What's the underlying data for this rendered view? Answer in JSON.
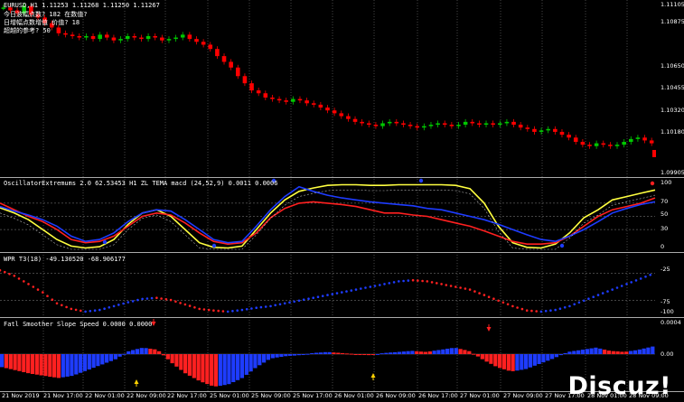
{
  "header": {
    "symbol_line": "EURUSD,H1  1.11253 1.11268 1.11250 1.11267",
    "info_lines": [
      "今日波幅点数? 182 在数值?",
      "日增幅点数增值 价值? 18",
      "超越的参考? 50"
    ]
  },
  "indicators": {
    "osc_title": "OscillatorExtremums 2.0 62.53453  H1 ZL TEMA macd (24,52,9) 0.0011 0.0006",
    "wpr_title": "WPR T3(18) -49.130520 -68.906177",
    "fss_title": "Fatl Smoother Slope Speed 0.0000 0.0000"
  },
  "axes": {
    "price_ticks": [
      "1.11105",
      "1.10875",
      "1.10650",
      "1.10455",
      "1.10320",
      "1.10180",
      "1.09905"
    ],
    "osc_ticks": [
      "100",
      "70",
      "50",
      "30",
      "0"
    ],
    "wpr_ticks": [
      "-25",
      "-75",
      "-100"
    ],
    "fss_ticks": [
      "0.0004",
      "0.00"
    ],
    "time_ticks": [
      "21 Nov 2019",
      "21 Nov 17:00",
      "22 Nov 01:00",
      "22 Nov 09:00",
      "22 Nov 17:00",
      "25 Nov 01:00",
      "25 Nov 09:00",
      "25 Nov 17:00",
      "26 Nov 01:00",
      "26 Nov 09:00",
      "26 Nov 17:00",
      "27 Nov 01:00",
      "27 Nov 09:00",
      "27 Nov 17:00",
      "28 Nov 01:00",
      "28 Nov 09:00"
    ]
  },
  "watermark": "Discuz!",
  "colors": {
    "bull": "#00c800",
    "bear": "#ff0000",
    "yellow": "#ffff40",
    "blue": "#1e3cff",
    "red": "#ff2020",
    "grid": "#ffffff",
    "axis": "#aaaaaa"
  },
  "chart_data": [
    {
      "type": "line",
      "panel": "price",
      "series": [
        {
          "name": "EURUSD,H1",
          "values": [
            1.1108,
            1.1106,
            1.1104,
            1.1109,
            1.1103,
            1.1101,
            1.1097,
            1.1094,
            1.109,
            1.1089,
            1.1088,
            1.1087,
            1.1088,
            1.1086,
            1.1089,
            1.1087,
            1.1085,
            1.1086,
            1.1088,
            1.1087,
            1.1086,
            1.1088,
            1.1087,
            1.1085,
            1.1086,
            1.1087,
            1.1089,
            1.1086,
            1.1084,
            1.1082,
            1.1079,
            1.1074,
            1.107,
            1.1066,
            1.106,
            1.1055,
            1.105,
            1.1048,
            1.1045,
            1.1044,
            1.1043,
            1.1042,
            1.1044,
            1.1043,
            1.1041,
            1.104,
            1.1038,
            1.1036,
            1.1034,
            1.1032,
            1.103,
            1.1028,
            1.1027,
            1.1026,
            1.1025,
            1.1027,
            1.1028,
            1.1027,
            1.1026,
            1.1025,
            1.1024,
            1.1025,
            1.1026,
            1.1027,
            1.1026,
            1.1025,
            1.1026,
            1.1028,
            1.1027,
            1.1026,
            1.1027,
            1.1026,
            1.1027,
            1.1028,
            1.1026,
            1.1024,
            1.1023,
            1.1021,
            1.1022,
            1.1023,
            1.1021,
            1.1019,
            1.1017,
            1.1014,
            1.1012,
            1.1011,
            1.1013,
            1.1012,
            1.1011,
            1.1012,
            1.1014,
            1.1016,
            1.1017,
            1.1015,
            1.1013
          ]
        }
      ]
    },
    {
      "type": "line",
      "panel": "oscillator",
      "ylim": [
        0,
        100
      ],
      "series": [
        {
          "name": "yellow",
          "values": [
            63,
            55,
            45,
            30,
            15,
            5,
            2,
            4,
            15,
            38,
            55,
            60,
            50,
            30,
            10,
            3,
            2,
            5,
            30,
            55,
            75,
            88,
            93,
            97,
            98,
            98,
            97,
            97,
            98,
            98,
            98,
            98,
            97,
            92,
            70,
            35,
            10,
            3,
            2,
            8,
            25,
            48,
            60,
            75,
            80,
            85,
            90
          ]
        },
        {
          "name": "red",
          "values": [
            70,
            60,
            50,
            42,
            30,
            15,
            10,
            12,
            20,
            35,
            50,
            55,
            52,
            40,
            25,
            12,
            8,
            10,
            25,
            48,
            62,
            70,
            72,
            70,
            68,
            65,
            60,
            55,
            55,
            52,
            50,
            45,
            40,
            35,
            28,
            20,
            12,
            8,
            8,
            10,
            20,
            35,
            50,
            60,
            65,
            70,
            78
          ]
        },
        {
          "name": "blue",
          "values": [
            65,
            58,
            52,
            45,
            35,
            20,
            12,
            15,
            25,
            42,
            55,
            60,
            58,
            45,
            30,
            15,
            10,
            12,
            35,
            60,
            80,
            95,
            88,
            82,
            78,
            75,
            72,
            70,
            68,
            66,
            62,
            60,
            55,
            50,
            45,
            38,
            30,
            22,
            15,
            12,
            20,
            30,
            42,
            55,
            62,
            68,
            72
          ]
        }
      ]
    },
    {
      "type": "scatter",
      "panel": "wpr",
      "ylim": [
        -100,
        0
      ],
      "series": [
        {
          "name": "WPR T3(18)",
          "values": [
            -20,
            -30,
            -45,
            -60,
            -80,
            -90,
            -95,
            -92,
            -85,
            -78,
            -72,
            -70,
            -74,
            -82,
            -90,
            -93,
            -95,
            -92,
            -88,
            -85,
            -80,
            -75,
            -70,
            -65,
            -60,
            -55,
            -50,
            -45,
            -40,
            -38,
            -40,
            -45,
            -50,
            -55,
            -65,
            -75,
            -85,
            -93,
            -95,
            -92,
            -85,
            -75,
            -65,
            -55,
            -45,
            -35,
            -25
          ]
        }
      ]
    },
    {
      "type": "bar",
      "panel": "fss",
      "series": [
        {
          "name": "Fatl Smoother Slope Speed",
          "values": [
            -0.00012,
            -0.00015,
            -0.00018,
            -0.0002,
            -0.00022,
            -0.0002,
            -0.00015,
            -0.0001,
            -5e-05,
            3e-05,
            6e-05,
            4e-05,
            -8e-05,
            -0.00018,
            -0.00025,
            -0.0003,
            -0.00028,
            -0.00022,
            -0.00012,
            -4e-05,
            -2e-05,
            -1e-05,
            1e-05,
            2e-05,
            1e-05,
            0.0,
            -1e-05,
            1e-05,
            2e-05,
            3e-05,
            2e-05,
            4e-05,
            6e-05,
            3e-05,
            -5e-05,
            -0.00012,
            -0.00016,
            -0.00014,
            -9e-05,
            -4e-05,
            2e-05,
            4e-05,
            6e-05,
            3e-05,
            2e-05,
            4e-05,
            7e-05
          ]
        }
      ]
    }
  ]
}
